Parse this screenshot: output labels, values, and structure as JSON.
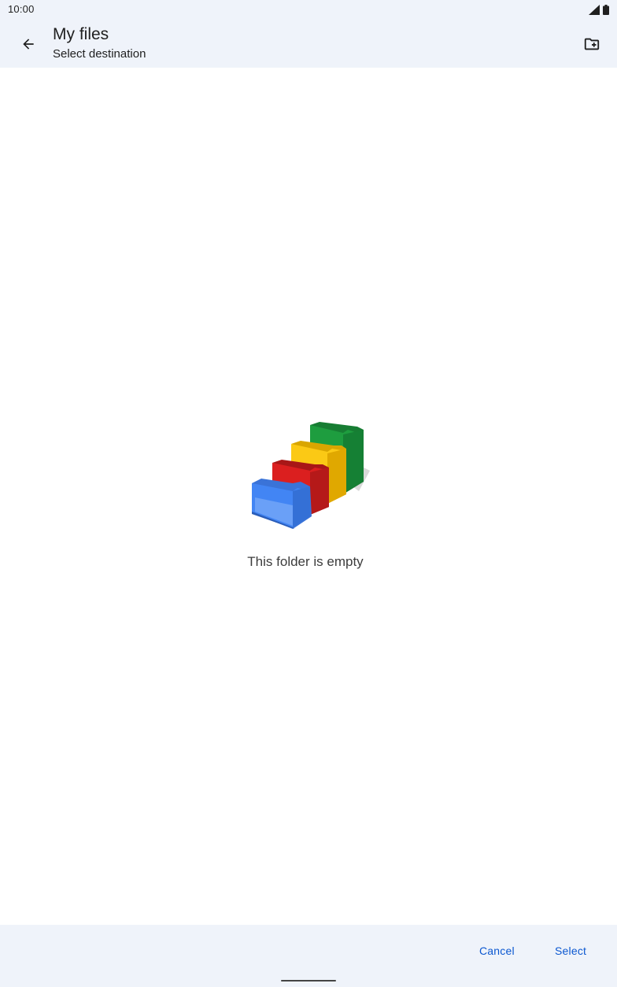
{
  "status_bar": {
    "time": "10:00",
    "icons": [
      "signal-icon",
      "battery-icon"
    ]
  },
  "app_bar": {
    "title": "My files",
    "subtitle": "Select destination",
    "back_icon": "arrow-back-icon",
    "new_folder_icon": "create-new-folder-icon"
  },
  "main": {
    "empty_illustration": "empty-folders-illustration",
    "empty_message": "This folder is empty"
  },
  "bottom_bar": {
    "cancel_label": "Cancel",
    "select_label": "Select"
  },
  "colors": {
    "bar_background": "#eff3fa",
    "accent": "#0b57d0",
    "folder_blue": "#4285f4",
    "folder_red": "#db1f1f",
    "folder_yellow": "#fbc915",
    "folder_green": "#1e9d3f"
  }
}
